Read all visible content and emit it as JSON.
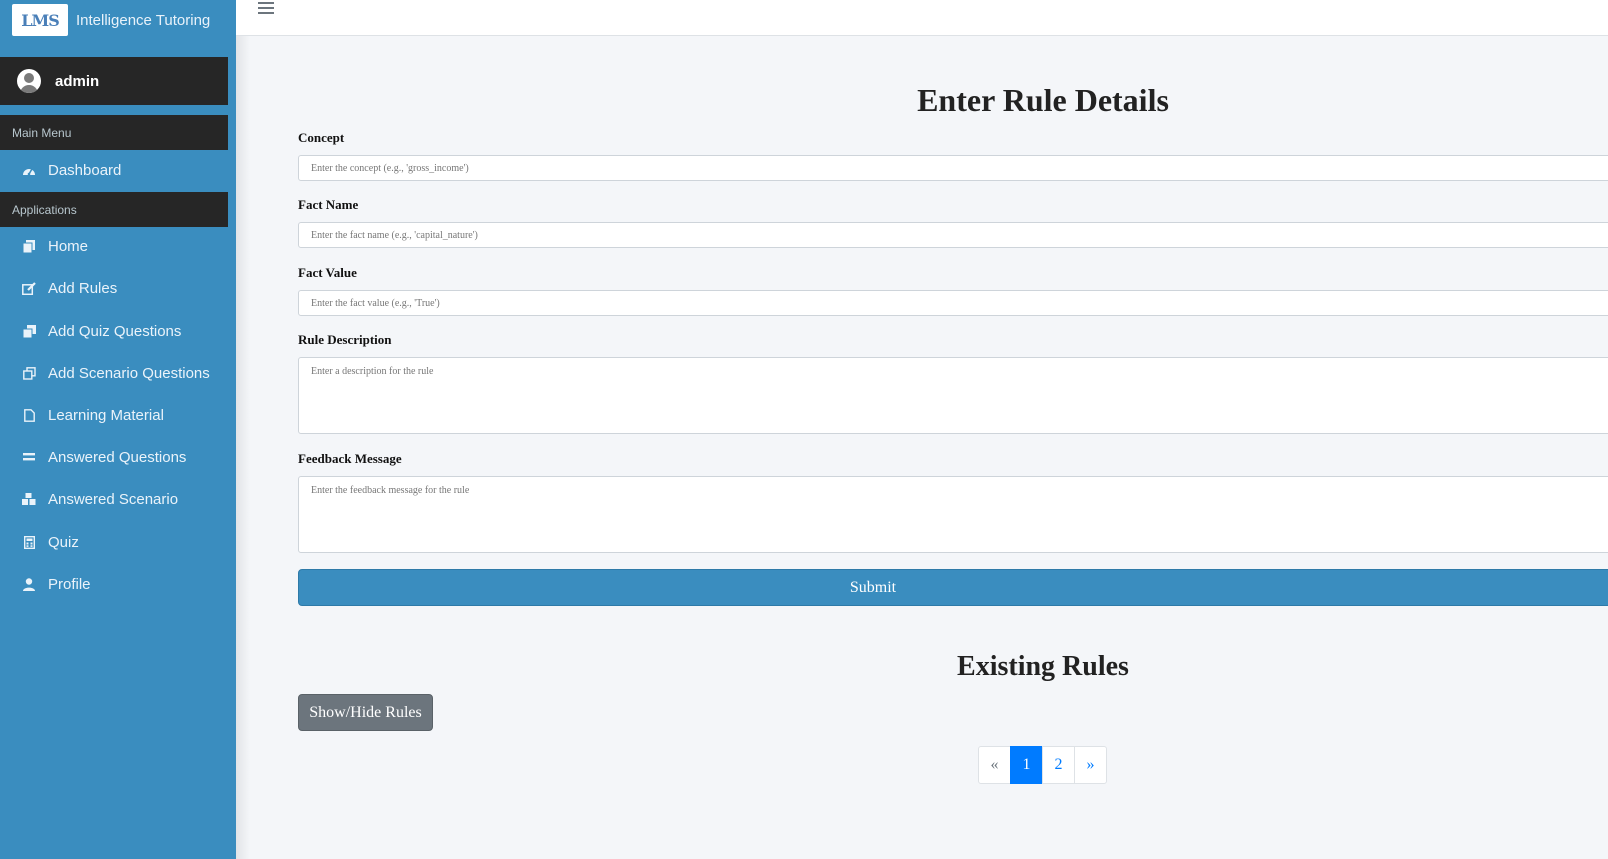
{
  "brand": {
    "logo_text": "LMS",
    "title": "Intelligence Tutoring"
  },
  "user": {
    "name": "admin"
  },
  "sidebar": {
    "main_menu_header": "Main Menu",
    "applications_header": "Applications",
    "dashboard": {
      "label": "Dashboard",
      "icon": "dashboard-icon"
    },
    "items": [
      {
        "label": "Home",
        "icon": "copy-icon"
      },
      {
        "label": "Add Rules",
        "icon": "edit-icon"
      },
      {
        "label": "Add Quiz Questions",
        "icon": "clone-icon"
      },
      {
        "label": "Add Scenario Questions",
        "icon": "clone-outline-icon"
      },
      {
        "label": "Learning Material",
        "icon": "file-icon"
      },
      {
        "label": "Answered Questions",
        "icon": "equals-icon"
      },
      {
        "label": "Answered Scenario",
        "icon": "boxes-icon"
      },
      {
        "label": "Quiz",
        "icon": "calculator-icon"
      },
      {
        "label": "Profile",
        "icon": "user-icon"
      }
    ]
  },
  "form": {
    "title": "Enter Rule Details",
    "concept": {
      "label": "Concept",
      "placeholder": "Enter the concept (e.g., 'gross_income')"
    },
    "fact_name": {
      "label": "Fact Name",
      "placeholder": "Enter the fact name (e.g., 'capital_nature')"
    },
    "fact_value": {
      "label": "Fact Value",
      "placeholder": "Enter the fact value (e.g., 'True')"
    },
    "rule_description": {
      "label": "Rule Description",
      "placeholder": "Enter a description for the rule"
    },
    "feedback_message": {
      "label": "Feedback Message",
      "placeholder": "Enter the feedback message for the rule"
    },
    "submit_label": "Submit"
  },
  "rules": {
    "title": "Existing Rules",
    "toggle_label": "Show/Hide Rules",
    "pagination": {
      "prev": "«",
      "pages": [
        "1",
        "2"
      ],
      "active": "1",
      "next": "»"
    }
  },
  "colors": {
    "sidebar": "#3a8dbf",
    "dark_band": "#262626",
    "submit": "#3a8dbf",
    "secondary": "#6c757d",
    "active_page": "#007bff"
  }
}
